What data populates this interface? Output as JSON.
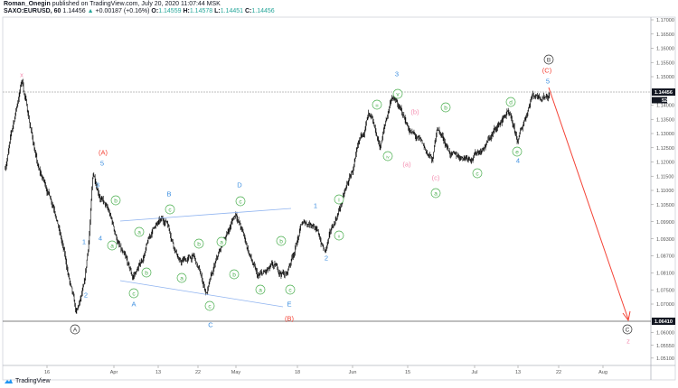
{
  "header": {
    "author": "Roman_Onegin",
    "published": "published on TradingView.com, July 20, 2020 11:07:44 MSK",
    "symbol": "SAXO:EURUSD, 60",
    "last": "1.14456",
    "change": "+0.00187 (+0.16%)",
    "o_label": "O:",
    "o": "1.14559",
    "h_label": "H:",
    "h": "1.14578",
    "l_label": "L:",
    "l": "1.14451",
    "c_label": "C:",
    "c": "1.14456"
  },
  "footer": {
    "brand": "TradingView"
  },
  "chart_data": {
    "type": "line",
    "title": "SAXO:EURUSD, 60",
    "series": [
      {
        "name": "EURUSD hourly (approx. path)",
        "points": [
          [
            "03-06",
            1.1183
          ],
          [
            "03-10",
            1.149
          ],
          [
            "03-14",
            1.1167
          ],
          [
            "03-18",
            1.104
          ],
          [
            "03-23",
            1.0652
          ],
          [
            "03-25",
            1.0754
          ],
          [
            "03-26",
            1.0913
          ],
          [
            "03-27",
            1.1151
          ],
          [
            "03-31",
            1.1008
          ],
          [
            "04-03",
            1.0881
          ],
          [
            "04-06",
            1.0786
          ],
          [
            "04-08",
            1.0833
          ],
          [
            "04-12",
            1.0976
          ],
          [
            "04-15",
            1.0992
          ],
          [
            "04-18",
            1.0849
          ],
          [
            "04-21",
            1.0865
          ],
          [
            "04-24",
            1.0738
          ],
          [
            "04-28",
            1.0913
          ],
          [
            "05-01",
            1.1024
          ],
          [
            "05-05",
            1.0865
          ],
          [
            "05-07",
            1.0786
          ],
          [
            "05-11",
            1.0817
          ],
          [
            "05-15",
            1.0802
          ],
          [
            "05-19",
            1.0976
          ],
          [
            "05-22",
            1.0992
          ],
          [
            "05-25",
            1.0881
          ],
          [
            "05-28",
            1.1008
          ],
          [
            "06-01",
            1.1167
          ],
          [
            "06-05",
            1.1357
          ],
          [
            "06-08",
            1.1246
          ],
          [
            "06-11",
            1.1437
          ],
          [
            "06-15",
            1.1325
          ],
          [
            "06-18",
            1.1262
          ],
          [
            "06-21",
            1.1198
          ],
          [
            "06-22",
            1.1325
          ],
          [
            "06-26",
            1.1214
          ],
          [
            "07-01",
            1.123
          ],
          [
            "07-04",
            1.1262
          ],
          [
            "07-10",
            1.1373
          ],
          [
            "07-13",
            1.1262
          ],
          [
            "07-16",
            1.1437
          ],
          [
            "07-20",
            1.14456
          ]
        ]
      }
    ],
    "y_ticks": [
      "1.17000",
      "1.16500",
      "1.16000",
      "1.15500",
      "1.15000",
      "1.14000",
      "1.13500",
      "1.13000",
      "1.12500",
      "1.12000",
      "1.11500",
      "1.11000",
      "1.10500",
      "1.09900",
      "1.09300",
      "1.08700",
      "1.08100",
      "1.07500",
      "1.07000",
      "1.06000",
      "1.05550",
      "1.05100"
    ],
    "x_ticks": [
      "16",
      "Apr",
      "13",
      "22",
      "May",
      "18",
      "Jun",
      "15",
      "Jul",
      "13",
      "22",
      "Aug"
    ],
    "price_tag": "1.14456",
    "countdown": "52:17",
    "level_tag": "1.06410",
    "ylim": [
      1.049,
      1.175
    ],
    "colors": {
      "bull": "#26a69a",
      "blue": "#3d8fe0",
      "green": "#4caf50",
      "pink": "#f48fb1",
      "red": "#f44336",
      "black": "#333333",
      "channel": "#90b4f0"
    },
    "annotations": [
      {
        "text": "x",
        "kind": "pink"
      },
      {
        "text": "(A)",
        "kind": "red"
      },
      {
        "text": "5",
        "kind": "blue"
      },
      {
        "text": "3",
        "kind": "blue"
      },
      {
        "text": "b",
        "kind": "green"
      },
      {
        "text": "4",
        "kind": "blue"
      },
      {
        "text": "a",
        "kind": "green"
      },
      {
        "text": "1",
        "kind": "blue"
      },
      {
        "text": "2",
        "kind": "blue"
      },
      {
        "text": "a",
        "kind": "green"
      },
      {
        "text": "b",
        "kind": "green"
      },
      {
        "text": "c",
        "kind": "green"
      },
      {
        "text": "A",
        "kind": "blue"
      },
      {
        "text": "B",
        "kind": "blue"
      },
      {
        "text": "c",
        "kind": "green"
      },
      {
        "text": "a",
        "kind": "green"
      },
      {
        "text": "b",
        "kind": "green"
      },
      {
        "text": "a",
        "kind": "green"
      },
      {
        "text": "c",
        "kind": "green"
      },
      {
        "text": "C",
        "kind": "blue"
      },
      {
        "text": "D",
        "kind": "blue"
      },
      {
        "text": "c",
        "kind": "green"
      },
      {
        "text": "b",
        "kind": "green"
      },
      {
        "text": "a",
        "kind": "green"
      },
      {
        "text": "b",
        "kind": "green"
      },
      {
        "text": "c",
        "kind": "green"
      },
      {
        "text": "E",
        "kind": "blue"
      },
      {
        "text": "(B)",
        "kind": "red"
      },
      {
        "text": "1",
        "kind": "blue"
      },
      {
        "text": "2",
        "kind": "blue"
      },
      {
        "text": "i",
        "kind": "green"
      },
      {
        "text": "ii",
        "kind": "green"
      },
      {
        "text": "3",
        "kind": "blue"
      },
      {
        "text": "v",
        "kind": "green"
      },
      {
        "text": "iii",
        "kind": "green"
      },
      {
        "text": "iv",
        "kind": "green"
      },
      {
        "text": "(b)",
        "kind": "pink"
      },
      {
        "text": "(a)",
        "kind": "pink"
      },
      {
        "text": "(c)",
        "kind": "pink"
      },
      {
        "text": "a",
        "kind": "green"
      },
      {
        "text": "b",
        "kind": "green"
      },
      {
        "text": "c",
        "kind": "green"
      },
      {
        "text": "d",
        "kind": "green"
      },
      {
        "text": "e",
        "kind": "green"
      },
      {
        "text": "4",
        "kind": "blue"
      },
      {
        "text": "5",
        "kind": "blue"
      },
      {
        "text": "(C)",
        "kind": "red"
      },
      {
        "text": "B",
        "kind": "black"
      },
      {
        "text": "A",
        "kind": "black"
      },
      {
        "text": "C",
        "kind": "black"
      },
      {
        "text": "z",
        "kind": "pink"
      }
    ]
  }
}
